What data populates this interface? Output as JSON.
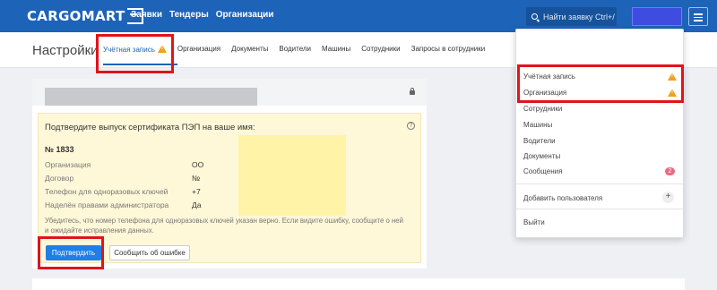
{
  "header": {
    "logo": "CARGOMART",
    "nav": [
      "Заявки",
      "Тендеры",
      "Организации"
    ],
    "search_placeholder": "Найти заявку Ctrl+/"
  },
  "settings": {
    "title": "Настройки",
    "tabs": [
      "Учётная запись",
      "Организация",
      "Документы",
      "Водители",
      "Машины",
      "Сотрудники",
      "Запросы в сотрудники"
    ]
  },
  "confirm": {
    "title": "Подтвердите выпуск сертификата ПЭП на ваше имя:",
    "number": "№ 1833",
    "fields": [
      {
        "label": "Организация",
        "value": "ОО"
      },
      {
        "label": "Договор",
        "value": "№"
      },
      {
        "label": "Телефон для одноразовых ключей",
        "value": "+7"
      },
      {
        "label": "Наделён правами администратора",
        "value": "Да"
      }
    ],
    "note": "Убедитесь, что номер телефона для одноразовых ключей указан верно. Если видите ошибку, сообщите о ней и ожидайте исправления данных.",
    "confirm_btn": "Подтвердить",
    "report_btn": "Сообщить об ошибке"
  },
  "dropdown": {
    "items": [
      "Учётная запись",
      "Организация",
      "Сотрудники",
      "Машины",
      "Водители",
      "Документы",
      "Сообщения"
    ],
    "messages_count": "2",
    "add_user": "Добавить пользователя",
    "logout": "Выйти"
  }
}
